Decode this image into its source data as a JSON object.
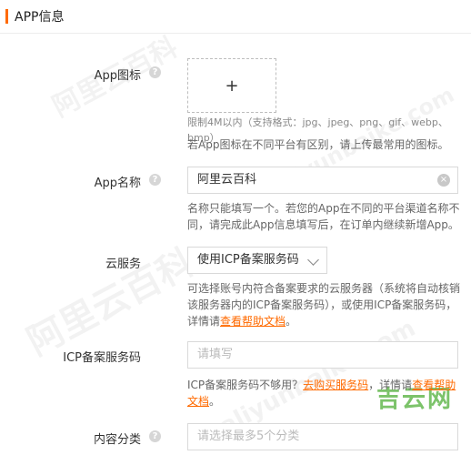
{
  "section": {
    "title": "APP信息"
  },
  "fields": {
    "icon": {
      "label": "App图标",
      "help": "?",
      "upload_symbol": "+",
      "limit": "限制4M以内（支持格式：jpg、jpeg、png、gif、webp、bmp）",
      "desc": "若App图标在不同平台有区别，请上传最常用的图标。"
    },
    "name": {
      "label": "App名称",
      "help": "?",
      "value": "阿里云百科",
      "clear": "×",
      "desc": "名称只能填写一个。若您的App在不同的平台渠道名称不同，请完成此App信息填写后，在订单内继续新增App。"
    },
    "cloud": {
      "label": "云服务",
      "selected": "使用ICP备案服务码",
      "desc_part1": "可选择账号内符合备案要求的云服务器（系统将自动核销该服务器内的ICP备案服务码），或使用ICP备案服务码，详情请",
      "desc_link": "查看帮助文档",
      "desc_end": "。"
    },
    "icp": {
      "label": "ICP备案服务码",
      "placeholder": "请填写",
      "desc_part1": "ICP备案服务码不够用？",
      "desc_link1": "去购买服务码",
      "desc_part2": "，详情请",
      "desc_link2": "查看帮助文档",
      "desc_end": "。"
    },
    "category": {
      "label": "内容分类",
      "help": "?",
      "placeholder": "请选择最多5个分类"
    }
  },
  "watermarks": {
    "main": "阿里云百科",
    "pinyin": "aliyunbaike.com",
    "site": "吉云网"
  }
}
